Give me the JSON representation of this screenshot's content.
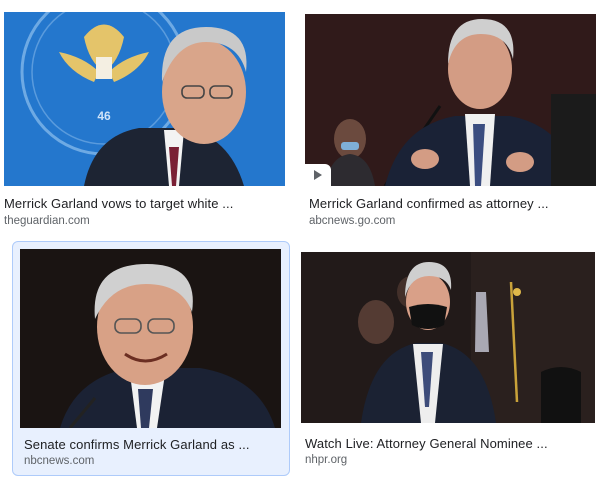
{
  "results": [
    {
      "title": "Merrick Garland vows to target white ...",
      "source": "theguardian.com",
      "thumb_icon": "portrait-photo-icon"
    },
    {
      "title": "Merrick Garland confirmed as attorney ...",
      "source": "abcnews.go.com",
      "thumb_icon": "video-thumbnail-icon"
    },
    {
      "title": "Senate confirms Merrick Garland as ...",
      "source": "nbcnews.com",
      "thumb_icon": "portrait-photo-icon"
    },
    {
      "title": "Watch Live: Attorney General Nominee ...",
      "source": "nhpr.org",
      "thumb_icon": "portrait-photo-icon"
    }
  ],
  "seal_text": "46",
  "colors": {
    "selected_bg": "#e8f0fe",
    "selected_border": "#aecbfa",
    "title": "#202124",
    "source": "#5f6368"
  }
}
